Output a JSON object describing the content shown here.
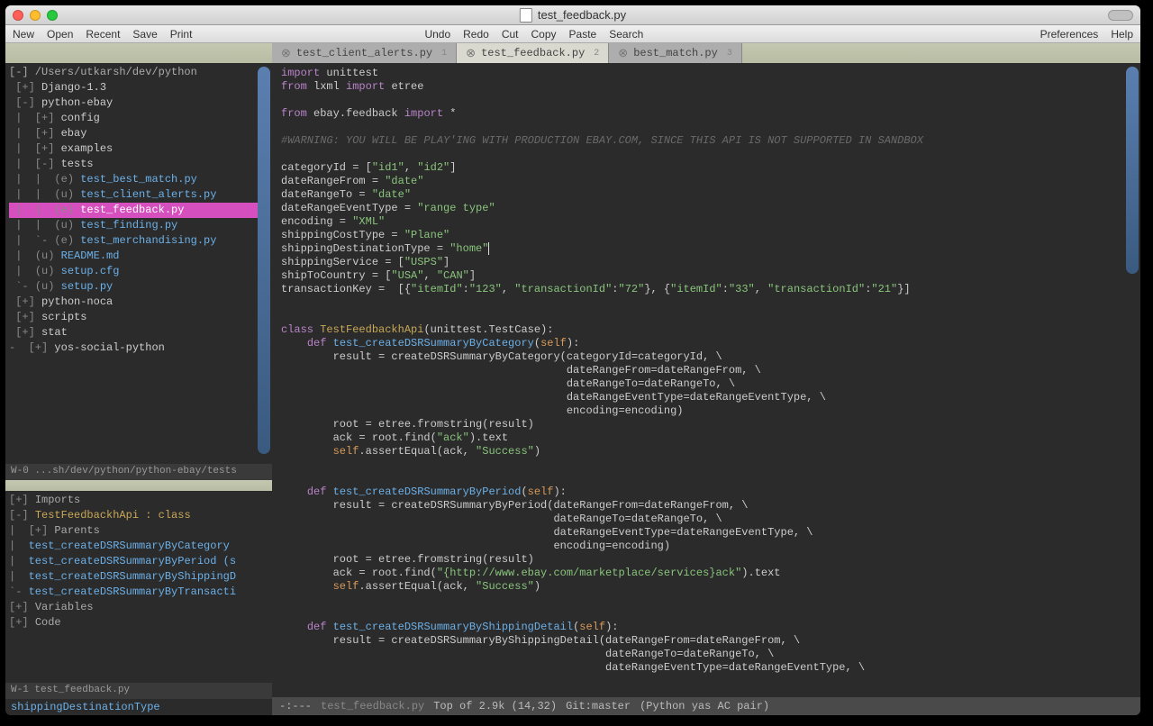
{
  "title": "test_feedback.py",
  "menu": {
    "left": [
      "New",
      "Open",
      "Recent",
      "Save",
      "Print"
    ],
    "center": [
      "Undo",
      "Redo",
      "Cut",
      "Copy",
      "Paste",
      "Search"
    ],
    "right": [
      "Preferences",
      "Help"
    ]
  },
  "tabs": [
    {
      "label": "test_client_alerts.py",
      "num": "1",
      "active": false
    },
    {
      "label": "test_feedback.py",
      "num": "2",
      "active": true
    },
    {
      "label": "best_match.py",
      "num": "3",
      "active": false
    }
  ],
  "sidebar": {
    "root_line": "[-] /Users/utkarsh/dev/python",
    "tree": [
      " [+] Django-1.3",
      " [-] python-ebay",
      " |  [+] config",
      " |  [+] ebay",
      " |  [+] examples",
      " |  [-] tests",
      " |  |  (e) test_best_match.py",
      " |  |  (u) test_client_alerts.py",
      " |  |  (e) test_feedback.py",
      " |  |  (u) test_finding.py",
      " |  `- (e) test_merchandising.py",
      " |  (u) README.md",
      " |  (u) setup.cfg",
      " `- (u) setup.py",
      " [+] python-noca",
      " [+] scripts",
      " [+] stat",
      " [+] yos-social-python"
    ],
    "path_status": "W-0 ...sh/dev/python/python-ebay/tests",
    "outline": [
      {
        "prefix": "[+] ",
        "cls": "",
        "text": "Imports"
      },
      {
        "prefix": "[-] ",
        "cls": "cls",
        "text": "TestFeedbackhApi : class"
      },
      {
        "prefix": "|  [+] ",
        "cls": "",
        "text": "Parents"
      },
      {
        "prefix": "|  ",
        "cls": "meth",
        "text": "test_createDSRSummaryByCategory"
      },
      {
        "prefix": "|  ",
        "cls": "meth",
        "text": "test_createDSRSummaryByPeriod (s"
      },
      {
        "prefix": "|  ",
        "cls": "meth",
        "text": "test_createDSRSummaryByShippingD"
      },
      {
        "prefix": "`- ",
        "cls": "meth",
        "text": "test_createDSRSummaryByTransacti"
      },
      {
        "prefix": "[+] ",
        "cls": "",
        "text": "Variables"
      },
      {
        "prefix": "[+] ",
        "cls": "",
        "text": "Code"
      }
    ],
    "outline_status": "W-1 test_feedback.py",
    "minibuffer": "shippingDestinationType"
  },
  "code": [
    [
      [
        "kw",
        "import"
      ],
      [
        null,
        " unittest"
      ]
    ],
    [
      [
        "kw",
        "from"
      ],
      [
        null,
        " lxml "
      ],
      [
        "kw",
        "import"
      ],
      [
        null,
        " etree"
      ]
    ],
    [],
    [
      [
        "kw",
        "from"
      ],
      [
        null,
        " ebay.feedback "
      ],
      [
        "kw",
        "import"
      ],
      [
        null,
        " *"
      ]
    ],
    [],
    [
      [
        "cm",
        "#WARNING: YOU WILL BE PLAY'ING WITH PRODUCTION EBAY.COM, SINCE THIS API IS NOT SUPPORTED IN SANDBOX"
      ]
    ],
    [],
    [
      [
        null,
        "categoryId = ["
      ],
      [
        "str",
        "\"id1\""
      ],
      [
        null,
        ", "
      ],
      [
        "str",
        "\"id2\""
      ],
      [
        null,
        "]"
      ]
    ],
    [
      [
        null,
        "dateRangeFrom = "
      ],
      [
        "str",
        "\"date\""
      ]
    ],
    [
      [
        null,
        "dateRangeTo = "
      ],
      [
        "str",
        "\"date\""
      ]
    ],
    [
      [
        null,
        "dateRangeEventType = "
      ],
      [
        "str",
        "\"range type\""
      ]
    ],
    [
      [
        null,
        "encoding = "
      ],
      [
        "str",
        "\"XML\""
      ]
    ],
    [
      [
        null,
        "shippingCostType = "
      ],
      [
        "str",
        "\"Plane\""
      ]
    ],
    [
      [
        null,
        "shippingDestinationType = "
      ],
      [
        "str",
        "\"home\""
      ],
      [
        "cursor",
        "|"
      ]
    ],
    [
      [
        null,
        "shippingService = ["
      ],
      [
        "str",
        "\"USPS\""
      ],
      [
        null,
        "]"
      ]
    ],
    [
      [
        null,
        "shipToCountry = ["
      ],
      [
        "str",
        "\"USA\""
      ],
      [
        null,
        ", "
      ],
      [
        "str",
        "\"CAN\""
      ],
      [
        null,
        "]"
      ]
    ],
    [
      [
        null,
        "transactionKey =  [{"
      ],
      [
        "str",
        "\"itemId\""
      ],
      [
        null,
        ":"
      ],
      [
        "str",
        "\"123\""
      ],
      [
        null,
        ", "
      ],
      [
        "str",
        "\"transactionId\""
      ],
      [
        null,
        ":"
      ],
      [
        "str",
        "\"72\""
      ],
      [
        null,
        "}, {"
      ],
      [
        "str",
        "\"itemId\""
      ],
      [
        null,
        ":"
      ],
      [
        "str",
        "\"33\""
      ],
      [
        null,
        ", "
      ],
      [
        "str",
        "\"transactionId\""
      ],
      [
        null,
        ":"
      ],
      [
        "str",
        "\"21\""
      ],
      [
        null,
        "}]"
      ]
    ],
    [],
    [],
    [
      [
        "kw",
        "class"
      ],
      [
        null,
        " "
      ],
      [
        "cls",
        "TestFeedbackhApi"
      ],
      [
        null,
        "(unittest.TestCase):"
      ]
    ],
    [
      [
        null,
        "    "
      ],
      [
        "kw",
        "def"
      ],
      [
        null,
        " "
      ],
      [
        "fn",
        "test_createDSRSummaryByCategory"
      ],
      [
        null,
        "("
      ],
      [
        "slf",
        "self"
      ],
      [
        null,
        "):"
      ]
    ],
    [
      [
        null,
        "        result = createDSRSummaryByCategory(categoryId=categoryId, \\"
      ]
    ],
    [
      [
        null,
        "                                            dateRangeFrom=dateRangeFrom, \\"
      ]
    ],
    [
      [
        null,
        "                                            dateRangeTo=dateRangeTo, \\"
      ]
    ],
    [
      [
        null,
        "                                            dateRangeEventType=dateRangeEventType, \\"
      ]
    ],
    [
      [
        null,
        "                                            encoding=encoding)"
      ]
    ],
    [
      [
        null,
        "        root = etree.fromstring(result)"
      ]
    ],
    [
      [
        null,
        "        ack = root.find("
      ],
      [
        "str",
        "\"ack\""
      ],
      [
        null,
        ").text"
      ]
    ],
    [
      [
        null,
        "        "
      ],
      [
        "slf",
        "self"
      ],
      [
        null,
        ".assertEqual(ack, "
      ],
      [
        "str",
        "\"Success\""
      ],
      [
        null,
        ")"
      ]
    ],
    [],
    [],
    [
      [
        null,
        "    "
      ],
      [
        "kw",
        "def"
      ],
      [
        null,
        " "
      ],
      [
        "fn",
        "test_createDSRSummaryByPeriod"
      ],
      [
        null,
        "("
      ],
      [
        "slf",
        "self"
      ],
      [
        null,
        "):"
      ]
    ],
    [
      [
        null,
        "        result = createDSRSummaryByPeriod(dateRangeFrom=dateRangeFrom, \\"
      ]
    ],
    [
      [
        null,
        "                                          dateRangeTo=dateRangeTo, \\"
      ]
    ],
    [
      [
        null,
        "                                          dateRangeEventType=dateRangeEventType, \\"
      ]
    ],
    [
      [
        null,
        "                                          encoding=encoding)"
      ]
    ],
    [
      [
        null,
        "        root = etree.fromstring(result)"
      ]
    ],
    [
      [
        null,
        "        ack = root.find("
      ],
      [
        "str",
        "\"{http://www.ebay.com/marketplace/services}ack\""
      ],
      [
        null,
        ").text"
      ]
    ],
    [
      [
        null,
        "        "
      ],
      [
        "slf",
        "self"
      ],
      [
        null,
        ".assertEqual(ack, "
      ],
      [
        "str",
        "\"Success\""
      ],
      [
        null,
        ")"
      ]
    ],
    [],
    [],
    [
      [
        null,
        "    "
      ],
      [
        "kw",
        "def"
      ],
      [
        null,
        " "
      ],
      [
        "fn",
        "test_createDSRSummaryByShippingDetail"
      ],
      [
        null,
        "("
      ],
      [
        "slf",
        "self"
      ],
      [
        null,
        "):"
      ]
    ],
    [
      [
        null,
        "        result = createDSRSummaryByShippingDetail(dateRangeFrom=dateRangeFrom, \\"
      ]
    ],
    [
      [
        null,
        "                                                  dateRangeTo=dateRangeTo, \\"
      ]
    ],
    [
      [
        null,
        "                                                  dateRangeEventType=dateRangeEventType, \\"
      ]
    ]
  ],
  "modeline": {
    "left": "-:---",
    "file": "test_feedback.py",
    "pos": "Top of 2.9k (14,32)",
    "git": "Git:master",
    "modes": "(Python yas AC pair)"
  }
}
